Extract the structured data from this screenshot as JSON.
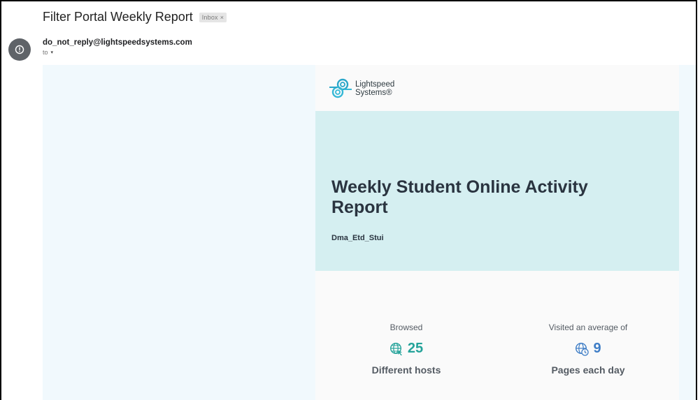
{
  "email": {
    "subject": "Filter Portal Weekly Report",
    "label": "Inbox",
    "label_remove": "×",
    "sender": "do_not_reply@lightspeedsystems.com",
    "to_label": "to",
    "to_caret": "▾"
  },
  "report": {
    "logo_line1": "Lightspeed",
    "logo_line2": "Systems®",
    "headline": "Weekly Student Online Activity Report",
    "org_name": "Dma_Etd_Stui",
    "stats": [
      {
        "caption": "Browsed",
        "value": "25",
        "label": "Different hosts",
        "icon": "globe-icon",
        "color": "#25a39a"
      },
      {
        "caption": "Visited an average of",
        "value": "9",
        "label": "Pages each day",
        "icon": "globe-clock-icon",
        "color": "#3e7dc6"
      }
    ]
  }
}
